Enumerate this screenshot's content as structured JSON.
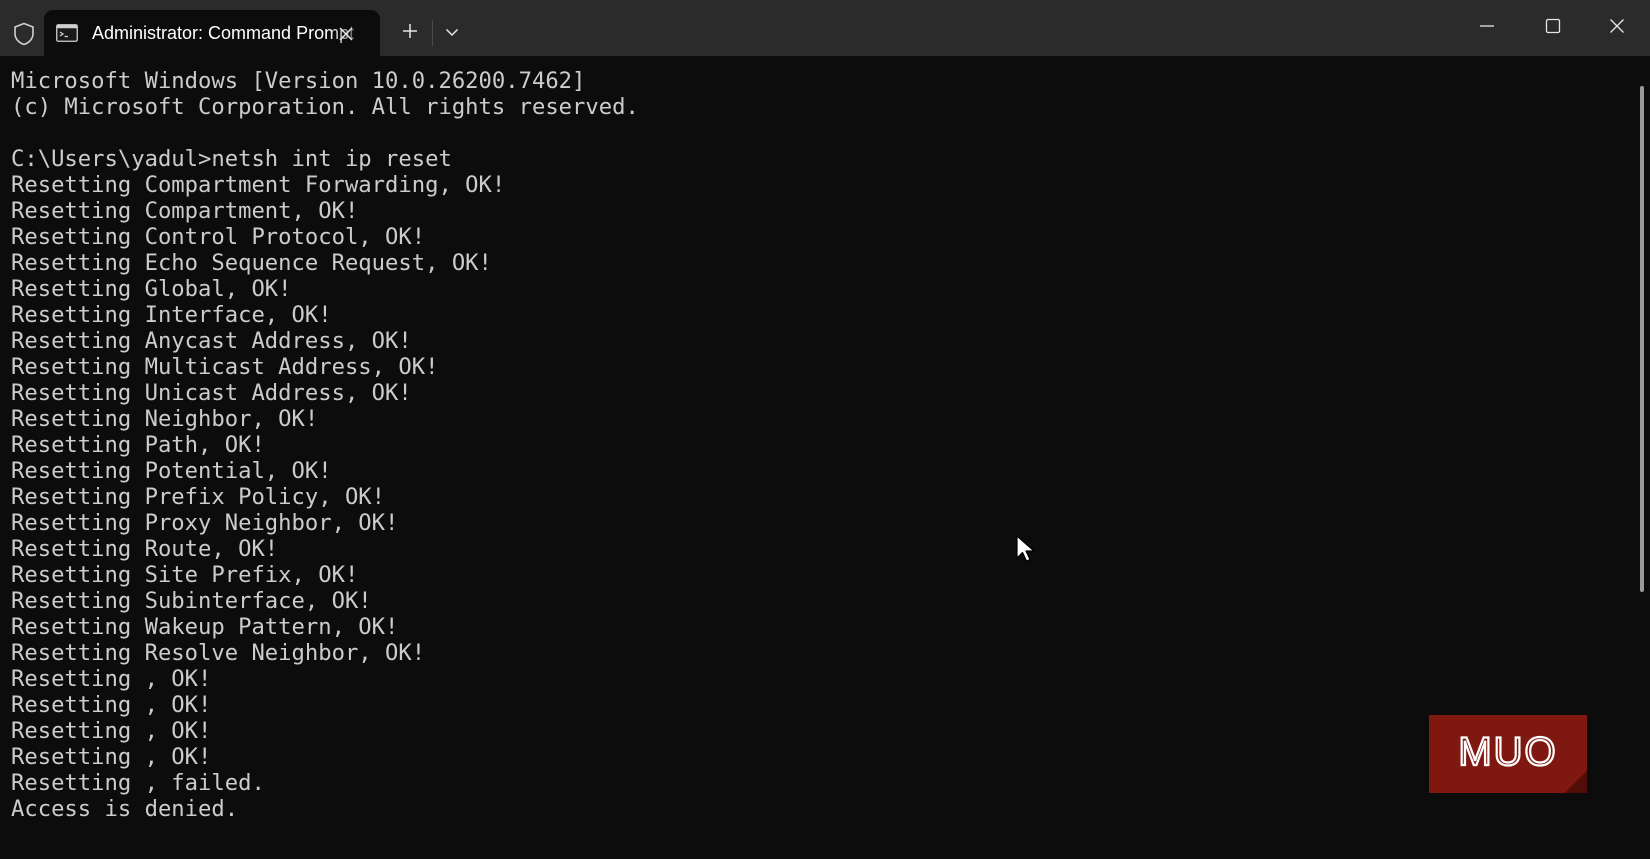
{
  "window": {
    "tab_title": "Administrator: Command Prompt",
    "icons": [
      "shield-icon",
      "cmd-icon",
      "close-icon",
      "plus-icon",
      "chevron-down-icon",
      "minimize-icon",
      "maximize-icon",
      "close-window-icon"
    ]
  },
  "terminal": {
    "lines": [
      "Microsoft Windows [Version 10.0.26200.7462]",
      "(c) Microsoft Corporation. All rights reserved.",
      "",
      "C:\\Users\\yadul>netsh int ip reset",
      "Resetting Compartment Forwarding, OK!",
      "Resetting Compartment, OK!",
      "Resetting Control Protocol, OK!",
      "Resetting Echo Sequence Request, OK!",
      "Resetting Global, OK!",
      "Resetting Interface, OK!",
      "Resetting Anycast Address, OK!",
      "Resetting Multicast Address, OK!",
      "Resetting Unicast Address, OK!",
      "Resetting Neighbor, OK!",
      "Resetting Path, OK!",
      "Resetting Potential, OK!",
      "Resetting Prefix Policy, OK!",
      "Resetting Proxy Neighbor, OK!",
      "Resetting Route, OK!",
      "Resetting Site Prefix, OK!",
      "Resetting Subinterface, OK!",
      "Resetting Wakeup Pattern, OK!",
      "Resetting Resolve Neighbor, OK!",
      "Resetting , OK!",
      "Resetting , OK!",
      "Resetting , OK!",
      "Resetting , OK!",
      "Resetting , failed.",
      "Access is denied."
    ]
  },
  "watermark": {
    "text": "MUO",
    "color": "#8b1a14"
  },
  "colors": {
    "titlebar": "#2b2b2b",
    "background": "#0c0c0c",
    "text": "#cccccc"
  }
}
